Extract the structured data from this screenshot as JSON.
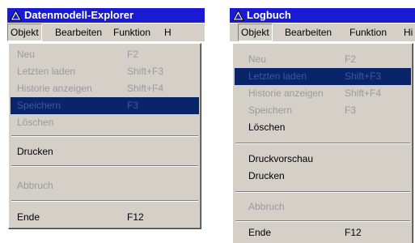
{
  "windows": [
    {
      "title": "Datenmodell-Explorer",
      "menubar": [
        "Objekt",
        "Bearbeiten",
        "Funktion",
        "H"
      ],
      "menu": [
        {
          "label": "Neu",
          "shortcut": "F2",
          "state": "disabled"
        },
        {
          "label": "Letzten laden",
          "shortcut": "Shift+F3",
          "state": "disabled"
        },
        {
          "label": "Historie anzeigen",
          "shortcut": "Shift+F4",
          "state": "disabled"
        },
        {
          "label": "Speichern",
          "shortcut": "F3",
          "state": "highlight"
        },
        {
          "label": "Löschen",
          "shortcut": "",
          "state": "disabled"
        },
        {
          "label": "Drucken",
          "shortcut": "",
          "state": "enabled"
        },
        {
          "label": "Abbruch",
          "shortcut": "",
          "state": "disabled"
        },
        {
          "label": "Ende",
          "shortcut": "F12",
          "state": "enabled"
        }
      ]
    },
    {
      "title": "Logbuch",
      "menubar": [
        "Objekt",
        "Bearbeiten",
        "Funktion",
        "Hi"
      ],
      "menu": [
        {
          "label": "Neu",
          "shortcut": "F2",
          "state": "disabled"
        },
        {
          "label": "Letzten laden",
          "shortcut": "Shift+F3",
          "state": "highlight"
        },
        {
          "label": "Historie anzeigen",
          "shortcut": "Shift+F4",
          "state": "disabled"
        },
        {
          "label": "Speichern",
          "shortcut": "F3",
          "state": "disabled"
        },
        {
          "label": "Löschen",
          "shortcut": "",
          "state": "enabled"
        },
        {
          "label": "Druckvorschau",
          "shortcut": "",
          "state": "enabled"
        },
        {
          "label": "Drucken",
          "shortcut": "",
          "state": "enabled"
        },
        {
          "label": "Abbruch",
          "shortcut": "",
          "state": "disabled"
        },
        {
          "label": "Ende",
          "shortcut": "F12",
          "state": "enabled"
        }
      ]
    }
  ],
  "colors": {
    "titlebar": "#1a1ad4",
    "menu_face": "#d4d0c8",
    "highlight": "#0a246a",
    "disabled_text": "#9a9a9a"
  }
}
